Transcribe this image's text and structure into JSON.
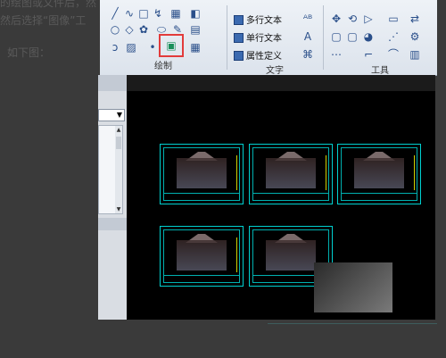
{
  "background_text": {
    "line1": "的绘图或文件后，然",
    "line2": "然后选择“图像”工",
    "line3": "如下图："
  },
  "ribbon": {
    "draw_panel": {
      "title": "绘制"
    },
    "text_panel": {
      "title": "文字",
      "multiline_text": "多行文本",
      "singleline_text": "单行文本",
      "attribute_def": "属性定义"
    },
    "tools_panel": {
      "title": "工具"
    }
  },
  "colors": {
    "cad_cyan": "#00d0d0",
    "highlight": "#e23b3b"
  },
  "left_pane": {
    "dropdown_arrow": "▼"
  }
}
